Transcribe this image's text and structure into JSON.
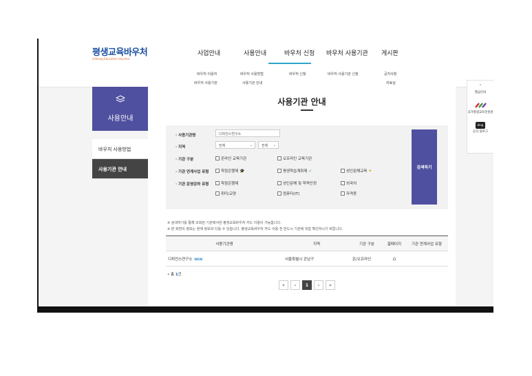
{
  "header": {
    "logo_text": "평생교육바우처",
    "logo_subtext": "Lifelong Education Voucher",
    "nav": [
      {
        "label": "사업안내"
      },
      {
        "label": "사용안내"
      },
      {
        "label": "바우처 신청"
      },
      {
        "label": "바우처 사용기관"
      },
      {
        "label": "게시판"
      }
    ],
    "submenu": {
      "col1": [
        "바우처 이용자",
        "바우처 사용기관"
      ],
      "col2": [
        "바우처 사용방법",
        "사용기관 안내"
      ],
      "col3": [
        "바우처 신청"
      ],
      "col4": [
        "바우처 사용기관 신청"
      ],
      "col5": [
        "공지사항",
        "자료실"
      ]
    }
  },
  "sidebar": {
    "title": "사용안내",
    "icon": "layers-icon",
    "items": [
      {
        "label": "바우처 사용방법"
      },
      {
        "label": "사용기관 안내"
      }
    ]
  },
  "page": {
    "title": "사용기관 안내"
  },
  "search": {
    "name_label": "사용기관명",
    "name_value": "디피언스연구소",
    "region_label": "지역",
    "region_select1": "전체",
    "region_select2": "전체",
    "type_label": "기관 구분",
    "type_options": [
      "온라인 교육기관",
      "오프라인 교육기관"
    ],
    "link_label": "기관 연계사업 유형",
    "link_options": [
      "학점은행제",
      "평생학습계좌제",
      "성인문해교육"
    ],
    "course_label": "기관 운영강좌 유형",
    "course_options": [
      "학점은행제",
      "성인문해 및 학력인정",
      "외국어",
      "취미/교양",
      "컴퓨터(IT)",
      "자격증"
    ],
    "button_label": "검색하기"
  },
  "notices": [
    "※ 검색하기를 통해 조회된 기관에서만 평생교육바우처 카드 이용이 가능합니다.",
    "※ 본 화면의 정보는 현재 정보와 다를 수 있습니다. 평생교육바우처 카드 이용 전 반드시 기관에 직접 확인하시기 바랍니다."
  ],
  "table": {
    "headers": [
      "사용기관명",
      "지역",
      "기관 구분",
      "홈페이지",
      "기관 연계사업 유형"
    ],
    "rows": [
      {
        "name": "디피언스연구소",
        "badge": "NEW",
        "region": "서울특별시 강남구",
        "type": "온/오프라인",
        "home": "⌂",
        "link": ""
      }
    ]
  },
  "total": {
    "prefix": "• 총 ",
    "count": "1",
    "suffix": "건"
  },
  "pagination": {
    "first": "«",
    "prev": "‹",
    "current": "1",
    "next": "›",
    "last": "»"
  },
  "right_quick": [
    {
      "label": "월급안내",
      "icon": "chevron-up-icon"
    },
    {
      "label": "국가평생교육진흥원",
      "icon": "nile-logo-icon"
    },
    {
      "label": "공식 블로그",
      "icon": "blog-icon"
    }
  ],
  "colors": {
    "brand": "#5050a0",
    "accent": "#2ea6c9",
    "dark_item": "#444444"
  }
}
